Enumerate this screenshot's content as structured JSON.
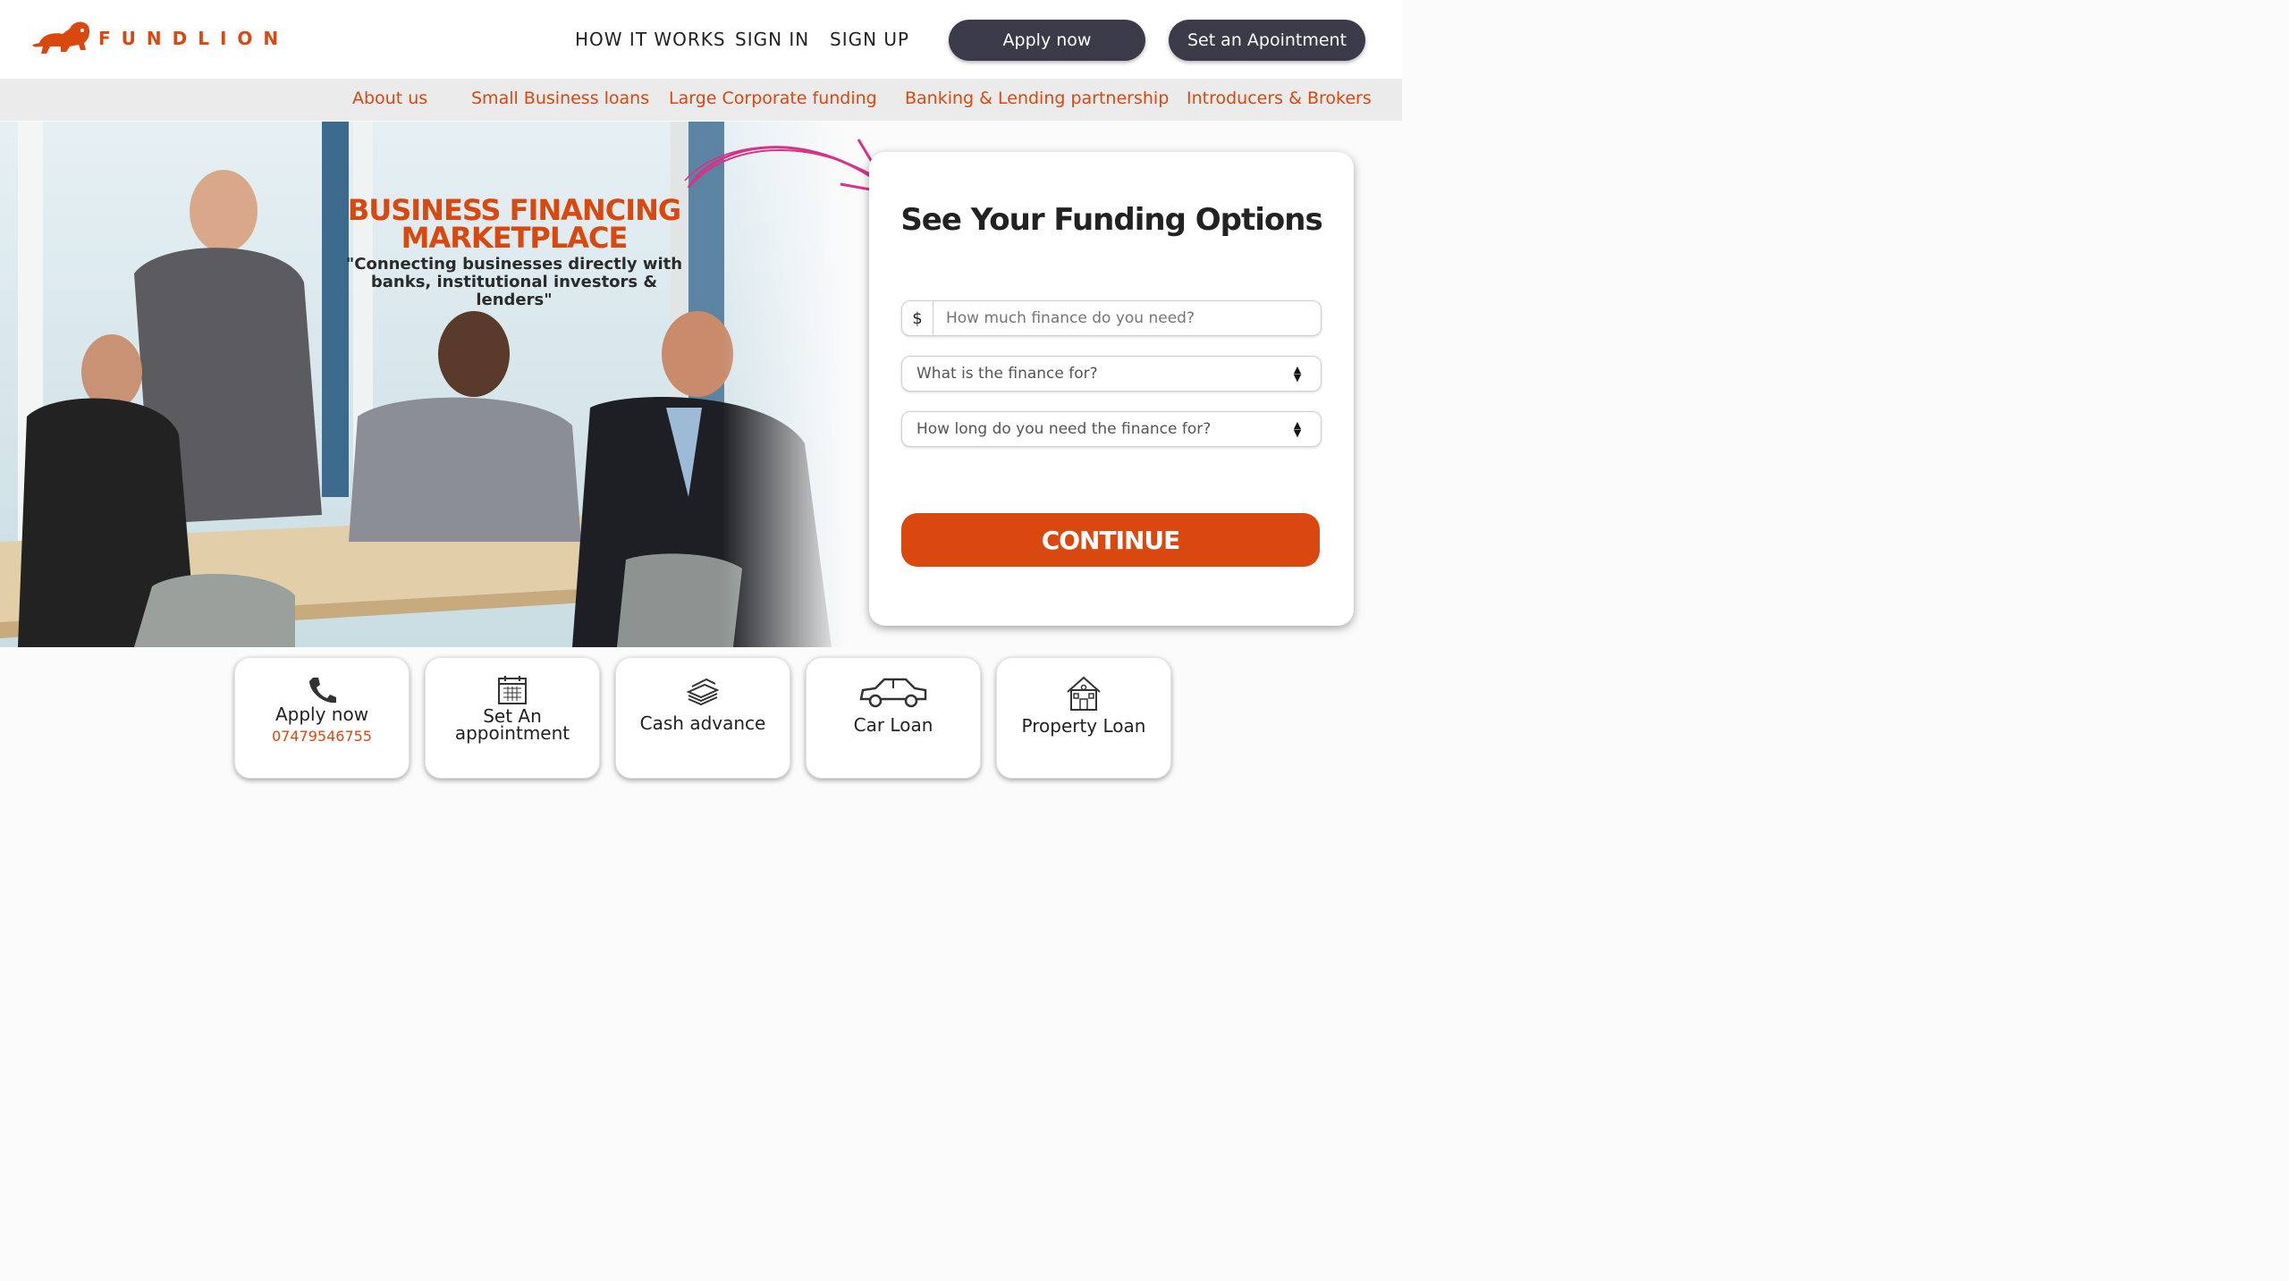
{
  "header": {
    "brand": "FUNDLION",
    "nav": {
      "how_it_works": "HOW IT WORKS",
      "sign_in": "SIGN IN",
      "sign_up": "SIGN UP"
    },
    "apply_now": "Apply now",
    "set_appointment": "Set an Apointment"
  },
  "subnav": [
    "About us",
    "Small Business loans",
    "Large Corporate funding",
    "Banking & Lending partnership",
    "Introducers & Brokers"
  ],
  "hero": {
    "title_line1": "BUSINESS FINANCING",
    "title_line2": "MARKETPLACE",
    "subtitle_line1": "\"Connecting businesses directly with",
    "subtitle_line2": "banks, institutional investors & lenders\""
  },
  "form": {
    "title": "See Your Funding Options",
    "currency_symbol": "$",
    "amount_placeholder": "How much finance do you need?",
    "purpose_placeholder": "What is the finance for?",
    "duration_placeholder": "How long do you need the finance for?",
    "continue_label": "CONTINUE"
  },
  "tiles": [
    {
      "label_line1": "Apply now",
      "phone": "07479546755",
      "icon": "phone-icon"
    },
    {
      "label_line1": "Set An",
      "label_line2": "appointment",
      "icon": "calendar-icon"
    },
    {
      "label_line1": "Cash advance",
      "icon": "cash-stack-icon"
    },
    {
      "label_line1": "Car Loan",
      "icon": "car-icon"
    },
    {
      "label_line1": "Property Loan",
      "icon": "house-icon"
    }
  ],
  "colors": {
    "brand_orange": "#d9480f",
    "dark_button": "#3b3a48",
    "arrow_pink": "#d6338a"
  }
}
